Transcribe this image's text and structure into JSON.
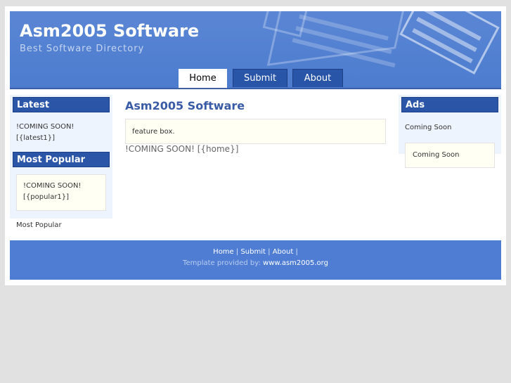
{
  "header": {
    "title": "Asm2005 Software",
    "tagline": "Best Software Directory"
  },
  "nav": {
    "tabs": [
      {
        "label": "Home",
        "active": true
      },
      {
        "label": "Submit",
        "active": false
      },
      {
        "label": "About",
        "active": false
      }
    ]
  },
  "left_sidebar": {
    "latest": {
      "heading": "Latest",
      "line1": "!COMING SOON!",
      "line2": "[{latest1}]"
    },
    "popular": {
      "heading": "Most Popular",
      "line1": "!COMING SOON!",
      "line2": "[{popular1}]",
      "footer_text": "Most Popular"
    }
  },
  "main": {
    "title": "Asm2005 Software",
    "feature_box": "feature box.",
    "body_text": "!COMING SOON! [{home}]"
  },
  "right_sidebar": {
    "heading": "Ads",
    "text": "Coming Soon",
    "box_text": "Coming Soon"
  },
  "footer": {
    "links": [
      "Home",
      "Submit",
      "About"
    ],
    "separator": "|",
    "credit_prefix": "Template provided by:",
    "credit_link": "www.asm2005.org"
  },
  "colors": {
    "header_blue": "#4d7ccf",
    "tab_blue": "#2855a8",
    "title_blue": "#3a5ca6",
    "page_bg": "#e1e1e1"
  }
}
